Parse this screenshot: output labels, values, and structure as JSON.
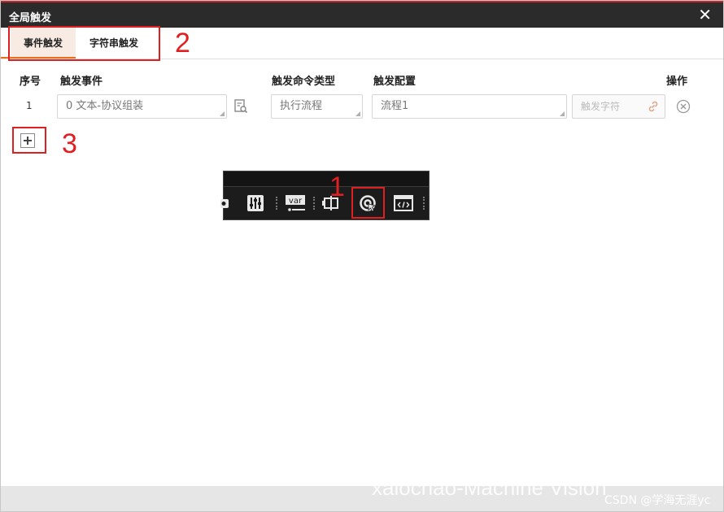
{
  "window": {
    "title": "全局触发",
    "close_icon": "close-icon"
  },
  "tabs": [
    {
      "label": "事件触发",
      "active": true
    },
    {
      "label": "字符串触发",
      "active": false
    }
  ],
  "table": {
    "headers": {
      "index": "序号",
      "event": "触发事件",
      "command_type": "触发命令类型",
      "config": "触发配置",
      "operation": "操作"
    },
    "rows": [
      {
        "index": "1",
        "event": "0 文本-协议组装",
        "command_type": "执行流程",
        "config": "流程1",
        "trigger_string_placeholder": "触发字符"
      }
    ]
  },
  "annotations": {
    "n1": "1",
    "n2": "2",
    "n3": "3",
    "color": "#e02020"
  },
  "toolbar_icons": [
    "camera-icon",
    "sliders-icon",
    "variable-icon",
    "io-module-icon",
    "global-trigger-icon",
    "script-icon"
  ],
  "watermark": {
    "line1": "xaiochao-Machine Vision",
    "line2": "CSDN @学海无涯yc"
  },
  "colors": {
    "title_bar": "#2b2b2b",
    "accent": "#e8701a",
    "active_tab_bg": "#f7ebe3"
  }
}
